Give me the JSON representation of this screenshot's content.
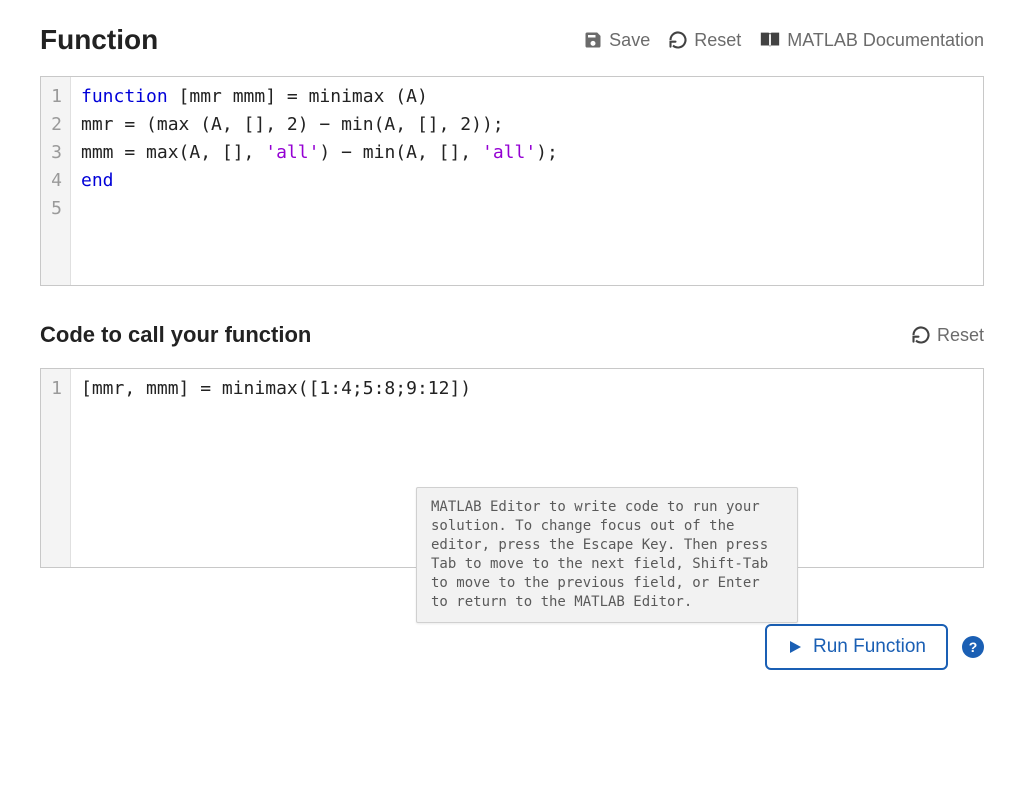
{
  "section1": {
    "title": "Function",
    "toolbar": {
      "save": "Save",
      "reset": "Reset",
      "docs": "MATLAB Documentation"
    },
    "code": {
      "line_numbers": [
        "1",
        "2",
        "3",
        "4",
        "5"
      ],
      "lines": [
        [
          {
            "t": "function",
            "c": "kw"
          },
          {
            "t": " [mmr mmm] = minimax (A)",
            "c": "tok"
          }
        ],
        [
          {
            "t": "mmr = (max (A, [], 2) − min(A, [], 2));",
            "c": "tok"
          }
        ],
        [
          {
            "t": "mmm = max(A, [], ",
            "c": "tok"
          },
          {
            "t": "'all'",
            "c": "str"
          },
          {
            "t": ") − min(A, [], ",
            "c": "tok"
          },
          {
            "t": "'all'",
            "c": "str"
          },
          {
            "t": ");",
            "c": "tok"
          }
        ],
        [
          {
            "t": "end",
            "c": "kw"
          }
        ],
        [
          {
            "t": "",
            "c": "tok"
          }
        ]
      ]
    }
  },
  "section2": {
    "title": "Code to call your function",
    "toolbar": {
      "reset": "Reset"
    },
    "code": {
      "line_numbers": [
        "1"
      ],
      "lines": [
        [
          {
            "t": "[mmr, mmm] = minimax([1:4;5:8;9:12])",
            "c": "tok"
          }
        ]
      ]
    },
    "tooltip": "MATLAB Editor to write code to run your solution. To change focus out of the editor, press the Escape Key. Then press Tab to move to the next field, Shift-Tab to move to the previous field, or Enter to return to the MATLAB Editor."
  },
  "run": {
    "label": "Run Function",
    "help": "?"
  }
}
